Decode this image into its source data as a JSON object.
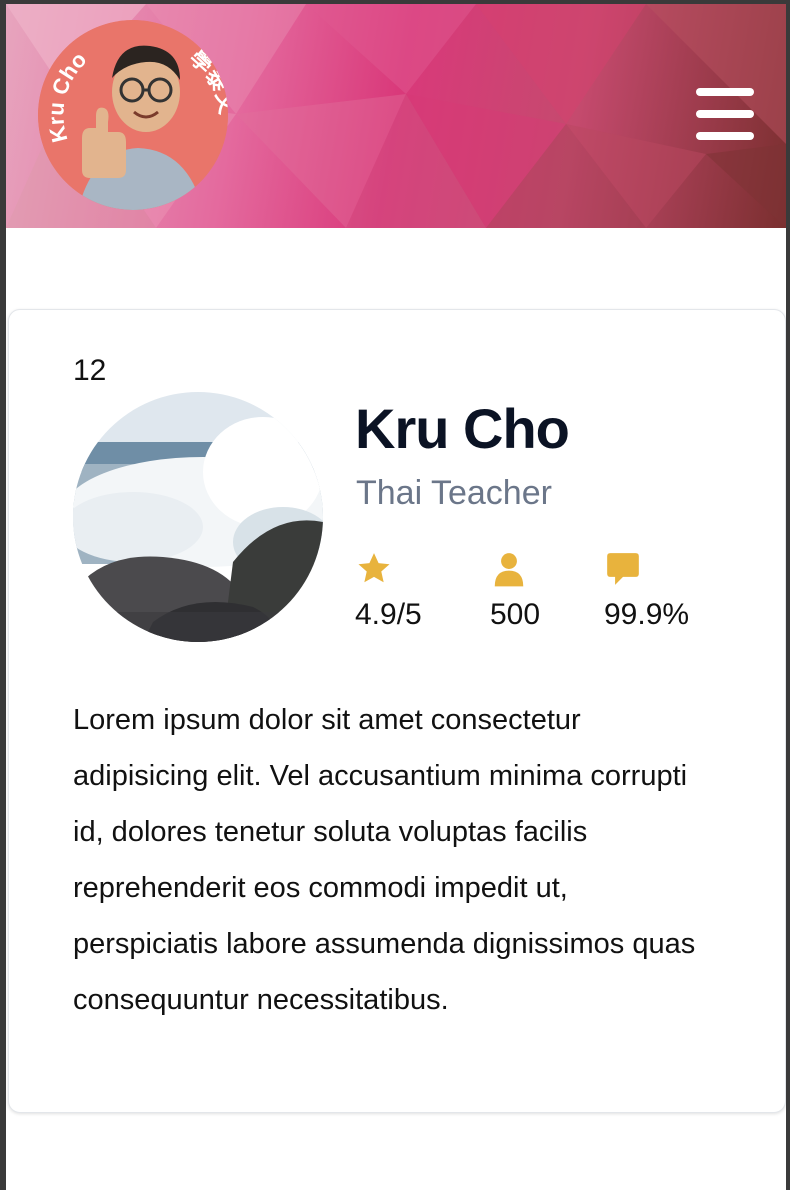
{
  "header": {
    "logo_text": "Kru Cho",
    "logo_chinese": "學泰文",
    "menu_icon": "hamburger-menu-icon"
  },
  "profile": {
    "count": "12",
    "name": "Kru Cho",
    "title": "Thai Teacher",
    "stats": [
      {
        "icon": "star-icon",
        "value": "4.9/5"
      },
      {
        "icon": "user-icon",
        "value": "500"
      },
      {
        "icon": "comment-icon",
        "value": "99.9%"
      }
    ],
    "bio": "Lorem ipsum dolor sit amet consectetur adipisicing elit. Vel accusantium minima corrupti id, dolores tenetur soluta voluptas facilis reprehenderit eos commodi impedit ut, perspiciatis labore assumenda dignissimos quas consequuntur necessitatibus."
  },
  "colors": {
    "accent": "#e8b33d",
    "name": "#0b1324",
    "subtitle": "#6b7689"
  }
}
